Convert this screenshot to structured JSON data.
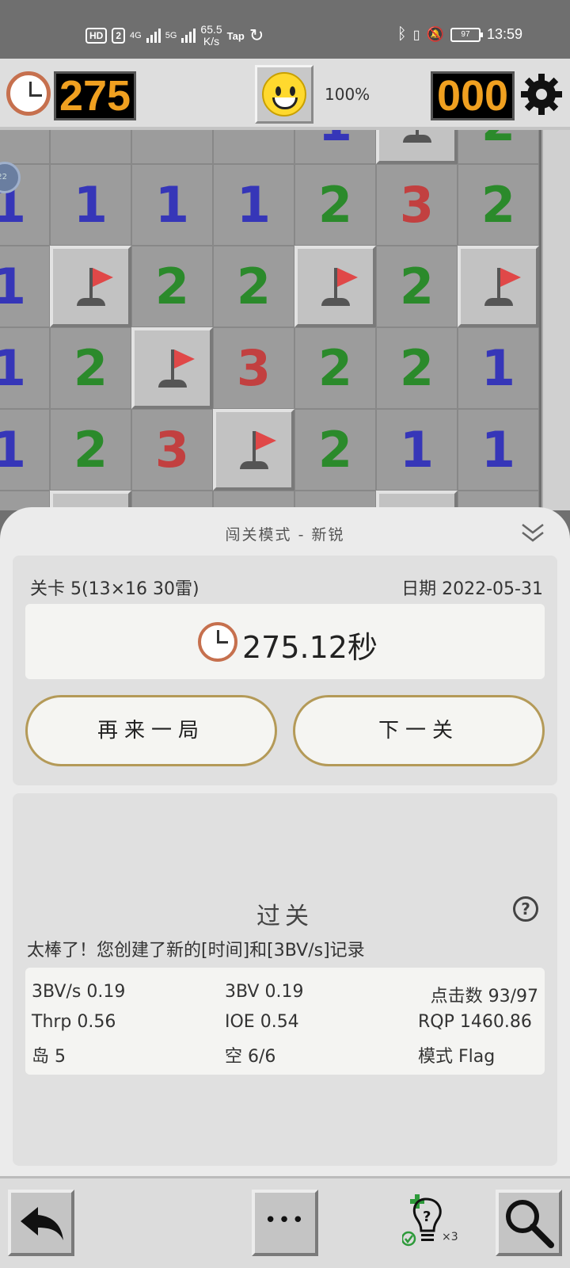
{
  "status_bar": {
    "hd": "HD",
    "sim": "2",
    "net1": "4G",
    "net2": "5G",
    "speed_value": "65.5",
    "speed_unit": "K/s",
    "tap": "Tap",
    "battery": "97",
    "time": "13:59"
  },
  "game_header": {
    "timer": "275",
    "zoom": "100%",
    "mines": "000"
  },
  "board": {
    "partial_top_row": [
      "",
      "",
      "",
      "1",
      "flag",
      "2"
    ],
    "rows": [
      [
        "1",
        "1",
        "1",
        "1",
        "2",
        "3",
        "2"
      ],
      [
        "1",
        "flag",
        "2",
        "2",
        "flag",
        "2",
        "flag"
      ],
      [
        "1",
        "2",
        "flag",
        "3",
        "2",
        "2",
        "1"
      ],
      [
        "1",
        "2",
        "3",
        "flag",
        "2",
        "1",
        "1"
      ]
    ],
    "avatar_badge": "22"
  },
  "result_panel": {
    "title": "闯关模式 - 新锐",
    "level": "关卡 5(13×16 30雷)",
    "date": "日期 2022-05-31",
    "time": "275.12秒",
    "retry_label": "再来一局",
    "next_label": "下一关",
    "pass_title": "过关",
    "message": "太棒了！您创建了新的[时间]和[3BV/s]记录",
    "stats": {
      "bv_per_s": "3BV/s 0.19",
      "bv": "3BV 0.19",
      "clicks": "点击数 93/97",
      "thrp": "Thrp 0.56",
      "ioe": "IOE 0.54",
      "rqp": "RQP 1460.86",
      "islands": "岛 5",
      "openings": "空 6/6",
      "mode": "模式 Flag"
    }
  },
  "toolbar": {
    "more": "•••",
    "hint_count": "×3"
  }
}
